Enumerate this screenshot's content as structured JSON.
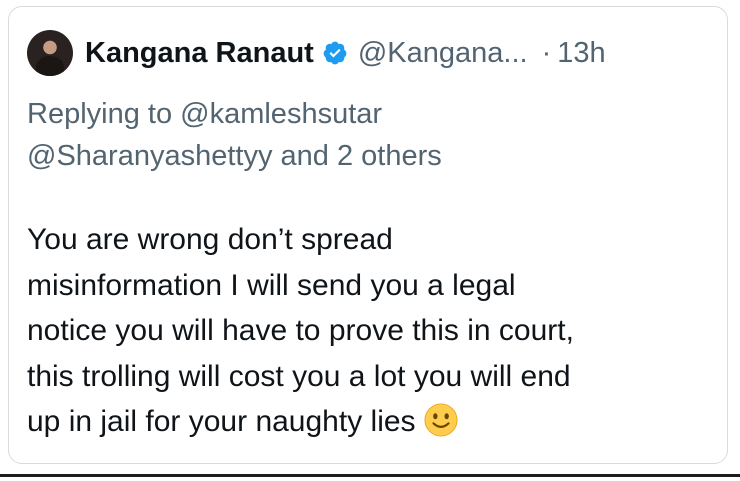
{
  "tweet": {
    "author_name": "Kangana Ranaut",
    "author_handle": "@Kangana...",
    "separator": "·",
    "time": "13h",
    "verified_color": "#1d9bf0",
    "avatar_icon": "profile-photo",
    "replying_line1": "Replying to @kamleshsutar",
    "replying_line2": "@Sharanyashettyy and 2 others",
    "text_lines": [
      "You are wrong don’t spread",
      "misinformation I will send you a legal",
      "notice you will have to prove this in court,",
      "this trolling will cost you a lot you will end",
      "up in jail for your naughty lies"
    ],
    "emoji": "slightly-smiling-face"
  },
  "colors": {
    "primary_text": "#0f1419",
    "secondary_text": "#536471",
    "card_border": "#d6dbe0"
  }
}
